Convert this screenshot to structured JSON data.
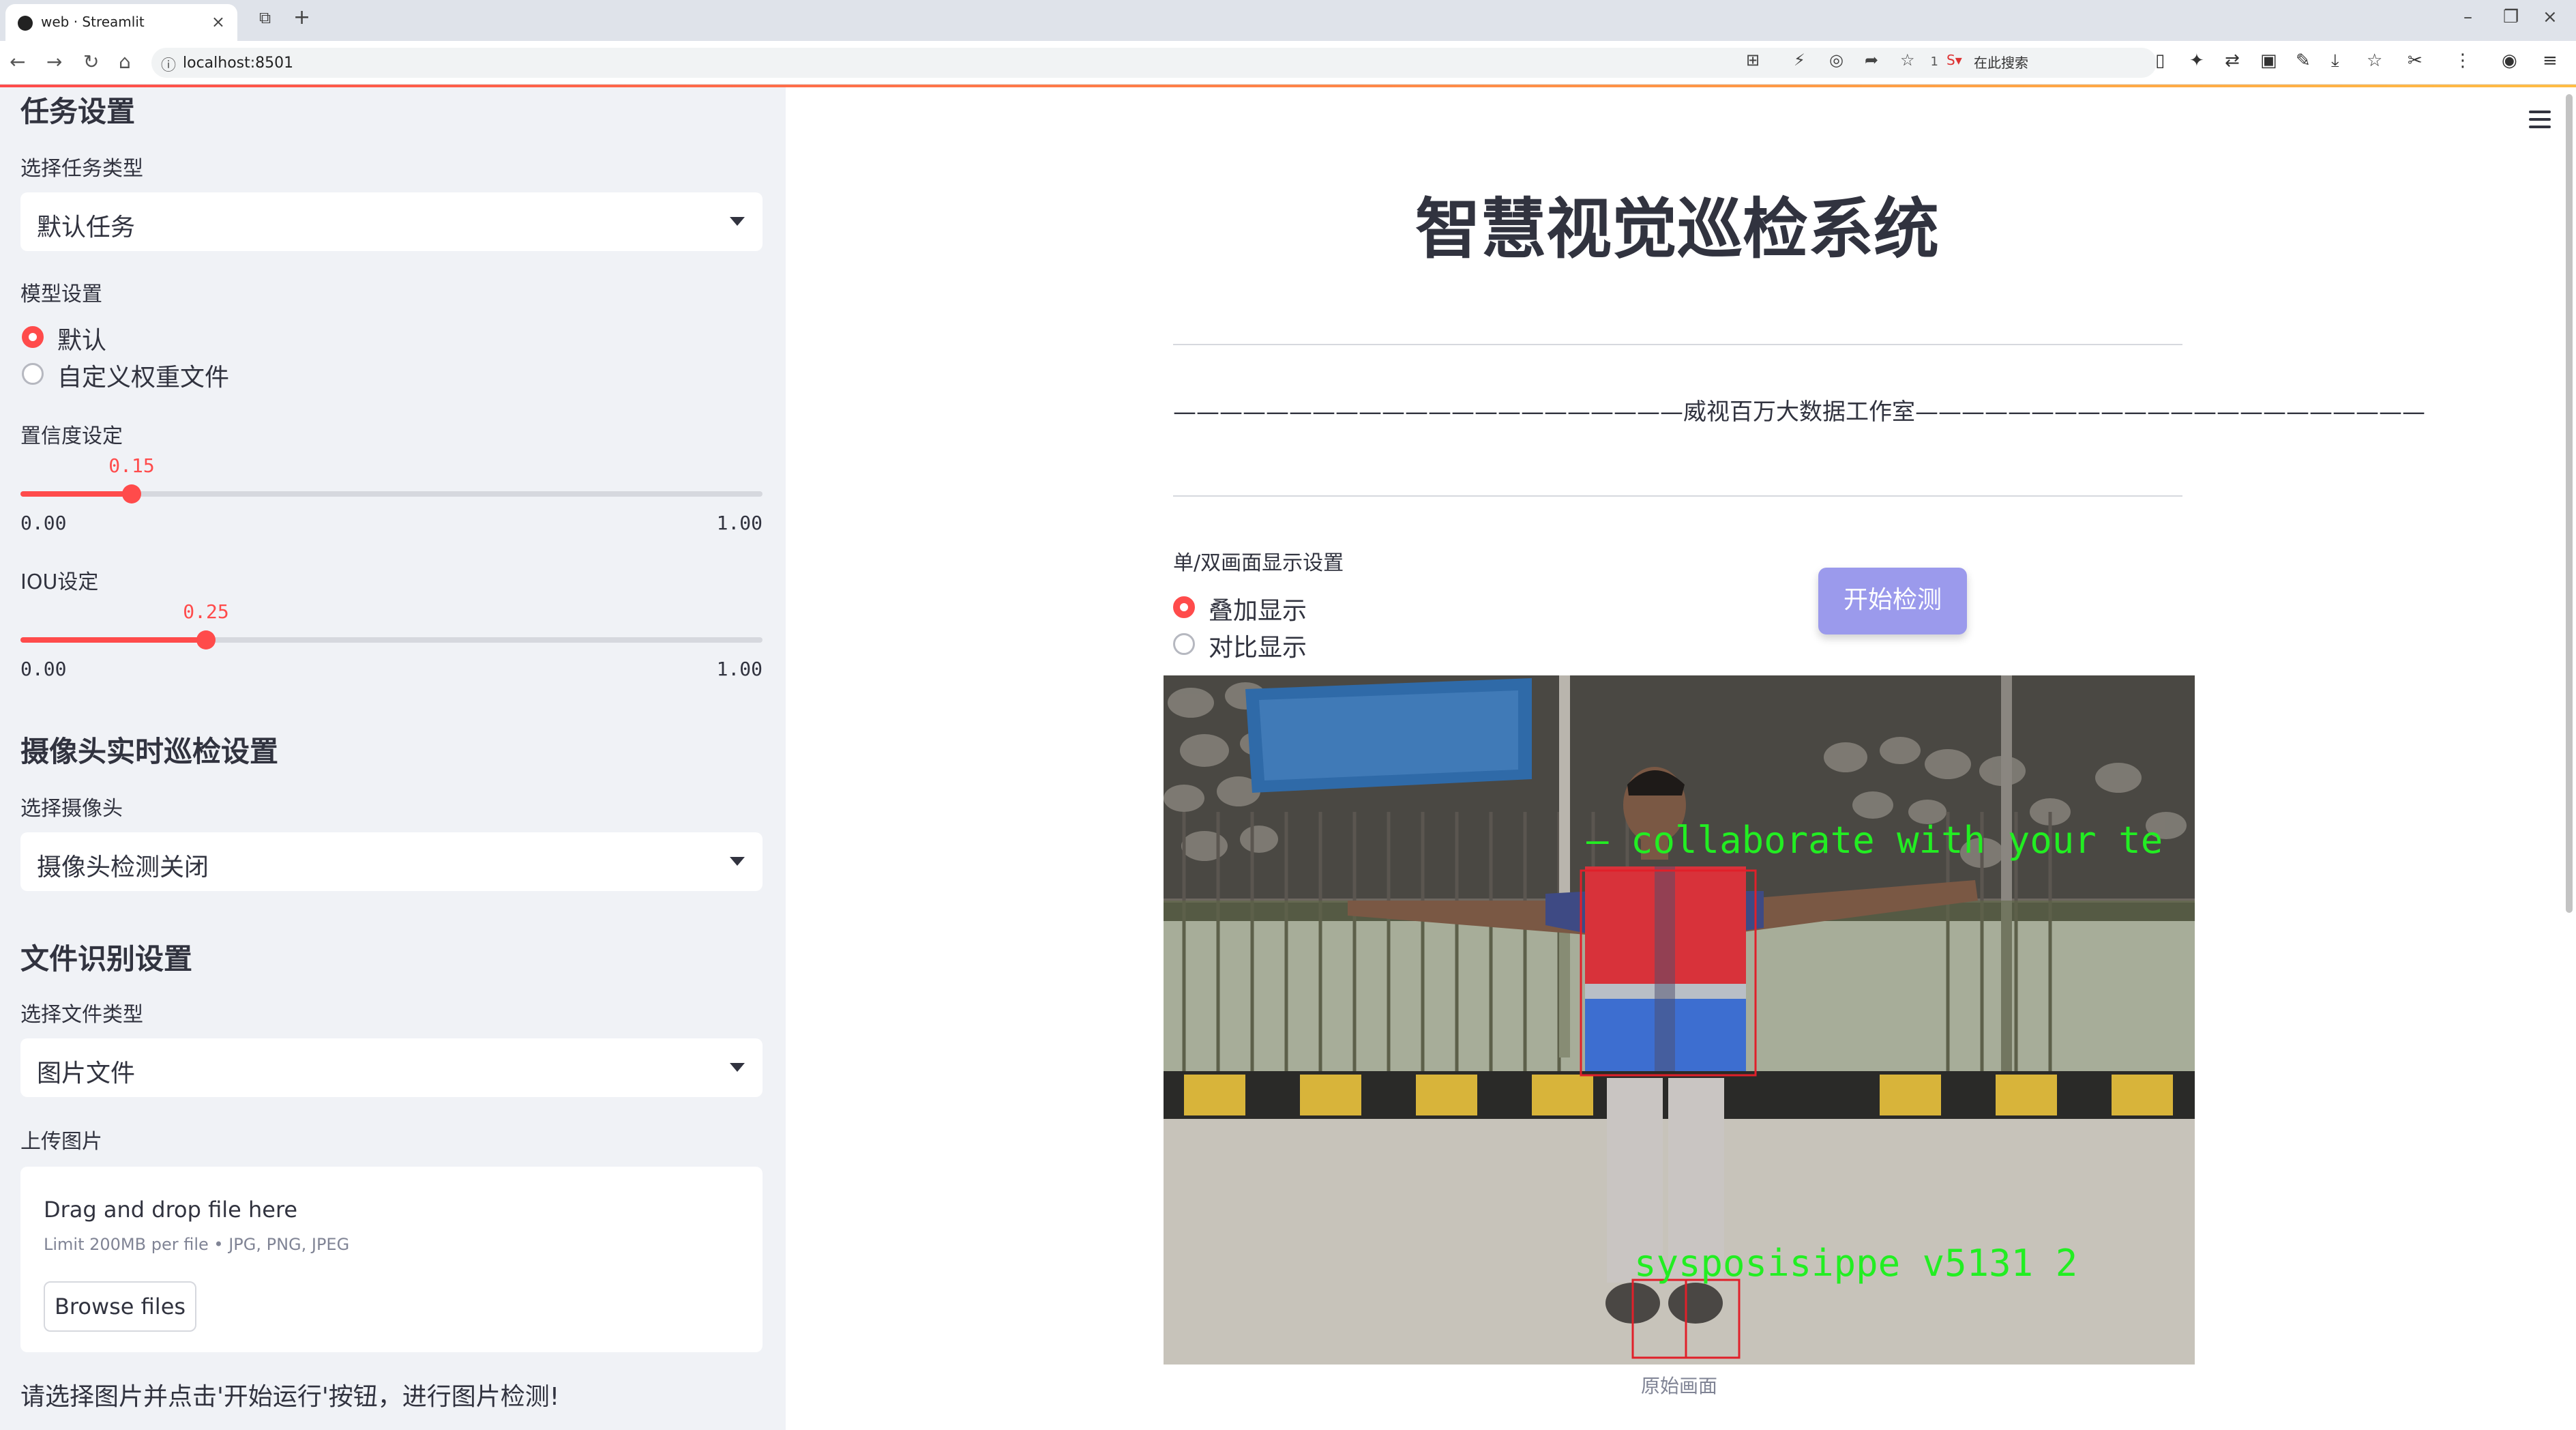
{
  "browser": {
    "tab_title": "web · Streamlit",
    "url": "localhost:8501",
    "zoom": "140%",
    "search_placeholder": "在此搜索"
  },
  "sidebar": {
    "task_heading": "任务设置",
    "task_type_label": "选择任务类型",
    "task_type_value": "默认任务",
    "model_label": "模型设置",
    "model_options": [
      "默认",
      "自定义权重文件"
    ],
    "model_selected": 0,
    "conf_label": "置信度设定",
    "conf": {
      "value": 0.15,
      "value_text": "0.15",
      "min": "0.00",
      "max": "1.00"
    },
    "iou_label": "IOU设定",
    "iou": {
      "value": 0.25,
      "value_text": "0.25",
      "min": "0.00",
      "max": "1.00"
    },
    "camera_heading": "摄像头实时巡检设置",
    "camera_label": "选择摄像头",
    "camera_value": "摄像头检测关闭",
    "file_heading": "文件识别设置",
    "file_type_label": "选择文件类型",
    "file_type_value": "图片文件",
    "upload_label": "上传图片",
    "upload": {
      "drag_text": "Drag and drop file here",
      "limit_text": "Limit 200MB per file • JPG, PNG, JPEG",
      "browse_label": "Browse files"
    },
    "hint": "请选择图片并点击'开始运行'按钮，进行图片检测!"
  },
  "main": {
    "title": "智慧视觉巡检系统",
    "studio_line": "——————————————————————威视百万大数据工作室——————————————————————",
    "display_label": "单/双画面显示设置",
    "display_options": [
      "叠加显示",
      "对比显示"
    ],
    "display_selected": 0,
    "start_button": "开始检测",
    "image_overlay_top": "— collaborate with your te",
    "image_overlay_bottom": "sysposisippe v5131 2",
    "caption": "原始画面"
  },
  "colors": {
    "accent": "#ff4b4b",
    "button": "#9b9aec",
    "sidebar_bg": "#f0f2f6",
    "detection_box": "#e0202a",
    "overlay_text": "#22ee22"
  }
}
